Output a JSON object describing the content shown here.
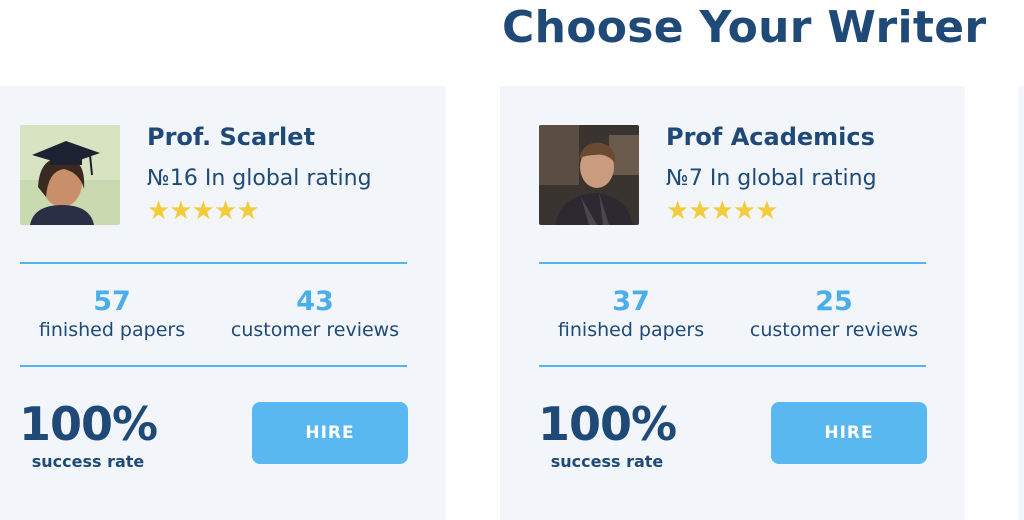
{
  "page": {
    "heading": "Choose Your Writer"
  },
  "writers": [
    {
      "name": "Prof. Scarlet",
      "rating": "№16 In global rating",
      "stars": "★★★★★",
      "finished_papers": "57",
      "finished_papers_label": "finished papers",
      "customer_reviews": "43",
      "customer_reviews_label": "customer reviews",
      "success_rate": "100%",
      "success_rate_label": "success rate",
      "hire_label": "HIRE"
    },
    {
      "name": "Prof Academics",
      "rating": "№7 In global rating",
      "stars": "★★★★★",
      "finished_papers": "37",
      "finished_papers_label": "finished papers",
      "customer_reviews": "25",
      "customer_reviews_label": "customer reviews",
      "success_rate": "100%",
      "success_rate_label": "success rate",
      "hire_label": "HIRE"
    }
  ],
  "colors": {
    "heading": "#1f4a78",
    "accent": "#58b8ef",
    "card_bg": "#f2f6fb",
    "star": "#f2cc3d"
  }
}
